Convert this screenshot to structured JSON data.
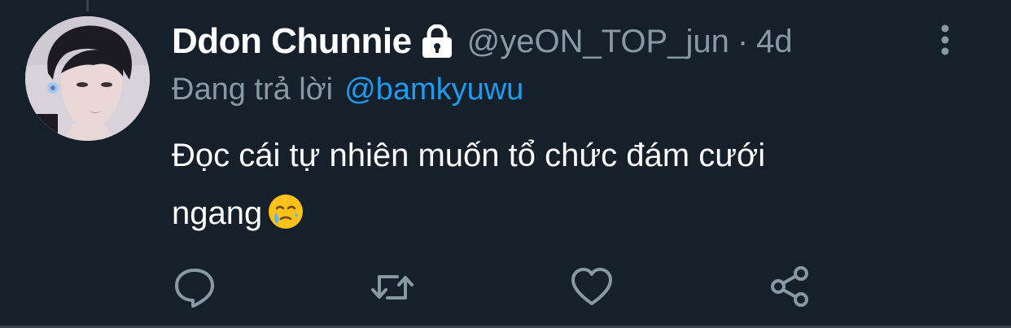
{
  "tweet": {
    "display_name": "Ddon Chunnie",
    "handle": "@yeON_TOP_jun",
    "separator": "·",
    "timestamp": "4d",
    "reply_prefix": "Đang trả lời",
    "reply_mention": "@bamkyuwu",
    "text_line_1": "Đọc cái tự nhiên muốn tổ chức đám cưới",
    "text_line_2": "ngang",
    "emoji_name": "face-holding-back-tears-emoji",
    "protected_icon": "lock-icon",
    "more_icon": "vertical-ellipsis-icon"
  },
  "actions": [
    {
      "name": "reply",
      "icon": "speech-bubble-icon"
    },
    {
      "name": "retweet",
      "icon": "retweet-arrows-icon"
    },
    {
      "name": "like",
      "icon": "heart-icon"
    },
    {
      "name": "share",
      "icon": "share-nodes-icon"
    }
  ],
  "colors": {
    "background": "#15202b",
    "primary_text": "#ffffff",
    "secondary_text": "#8899a6",
    "mention": "#1d9bf0",
    "divider": "#38444d"
  }
}
